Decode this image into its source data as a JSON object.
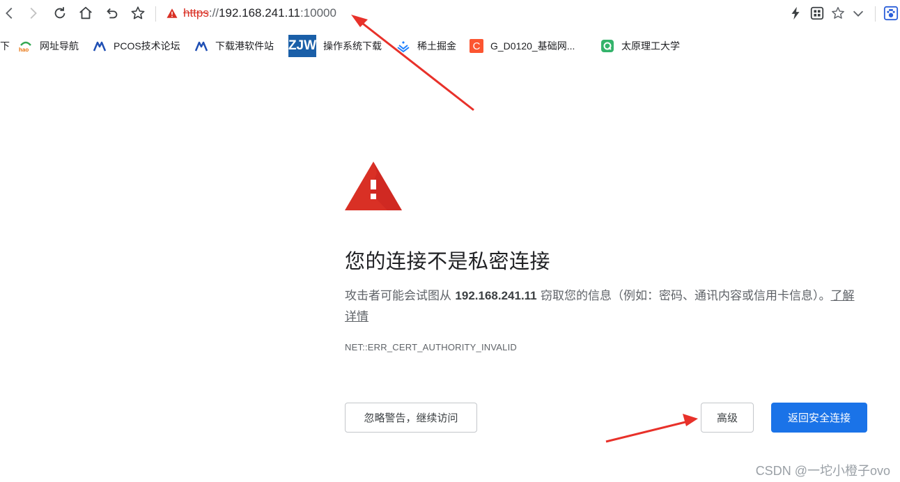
{
  "toolbar": {
    "back_icon": "chevron-left-icon",
    "forward_icon": "chevron-right-icon",
    "reload_icon": "reload-icon",
    "home_icon": "home-icon",
    "undo_icon": "undo-icon",
    "bookmark_icon": "star-icon",
    "url": {
      "scheme": "https",
      "separator": "://",
      "host": "192.168.241.11",
      "port": ":10000"
    },
    "right_icons": [
      "lightning-icon",
      "qr-grid-icon",
      "star-icon",
      "chevron-down-icon",
      "paw-icon"
    ]
  },
  "bookmarks": [
    {
      "label": "下",
      "icon": "bookmark-partial-icon"
    },
    {
      "label": "网址导航",
      "icon": "hao-logo-icon"
    },
    {
      "label": "PCOS技术论坛",
      "icon": "pcos-logo-icon"
    },
    {
      "label": "下载港软件站",
      "icon": "pcos-logo-icon"
    },
    {
      "label": "操作系统下载",
      "icon": "zjw-logo-icon",
      "icon_text": "ZJW"
    },
    {
      "label": "稀土掘金",
      "icon": "juejin-logo-icon"
    },
    {
      "label": "G_D0120_基础网...",
      "icon": "csdn-c-logo-icon",
      "icon_text": "C"
    },
    {
      "label": "太原理工大学",
      "icon": "green-q-logo-icon"
    }
  ],
  "page": {
    "title": "您的连接不是私密连接",
    "desc_before": "攻击者可能会试图从 ",
    "desc_host": "192.168.241.11",
    "desc_after": " 窃取您的信息（例如：密码、通讯内容或信用卡信息）。",
    "learn_more": "了解详情",
    "error_code": "NET::ERR_CERT_AUTHORITY_INVALID",
    "ignore_button": "忽略警告，继续访问",
    "advanced_button": "高级",
    "back_button": "返回安全连接"
  },
  "watermark": "CSDN @一坨小橙子ovo",
  "colors": {
    "warning_red": "#d93025",
    "primary_blue": "#1a73e8",
    "annotation_arrow": "#e8312a"
  }
}
